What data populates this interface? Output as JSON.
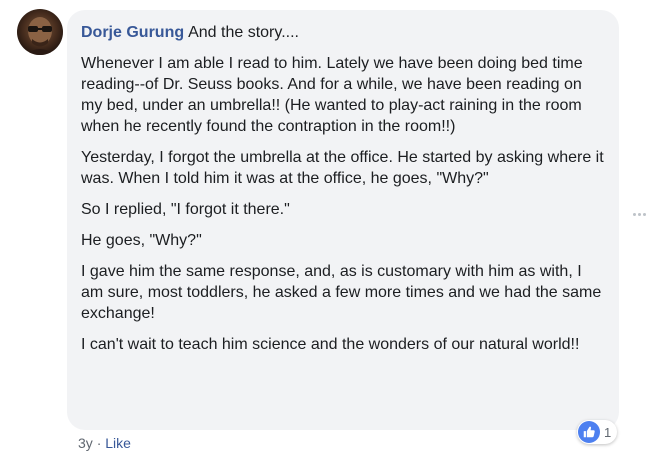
{
  "comment": {
    "author": "Dorje Gurung",
    "intro": "And the story....",
    "paragraphs": [
      "Whenever I am able I read to him. Lately we have been doing bed time reading--of Dr. Seuss books. And for a while, we have been reading on my bed, under an umbrella!! (He wanted to play-act raining in the room when he recently found the contraption in the room!!)",
      "Yesterday, I forgot the umbrella at the office. He started by asking where it was. When I told him it was at the office, he goes, \"Why?\"",
      "So I replied, \"I forgot it there.\"",
      "He goes, \"Why?\"",
      "I gave him the same response, and, as is customary with him as with, I am sure, most toddlers, he asked a few more times and we had the same exchange!",
      "I can't wait to teach him science and the wonders of our natural world!!"
    ],
    "timestamp": "3y",
    "separator": "·",
    "like_label": "Like",
    "reaction_count": "1",
    "reaction_icon": "thumbs-up-icon"
  },
  "colors": {
    "author_blue": "#385898",
    "bubble_bg": "#f2f3f5",
    "like_icon_bg": "#4d80f0"
  }
}
